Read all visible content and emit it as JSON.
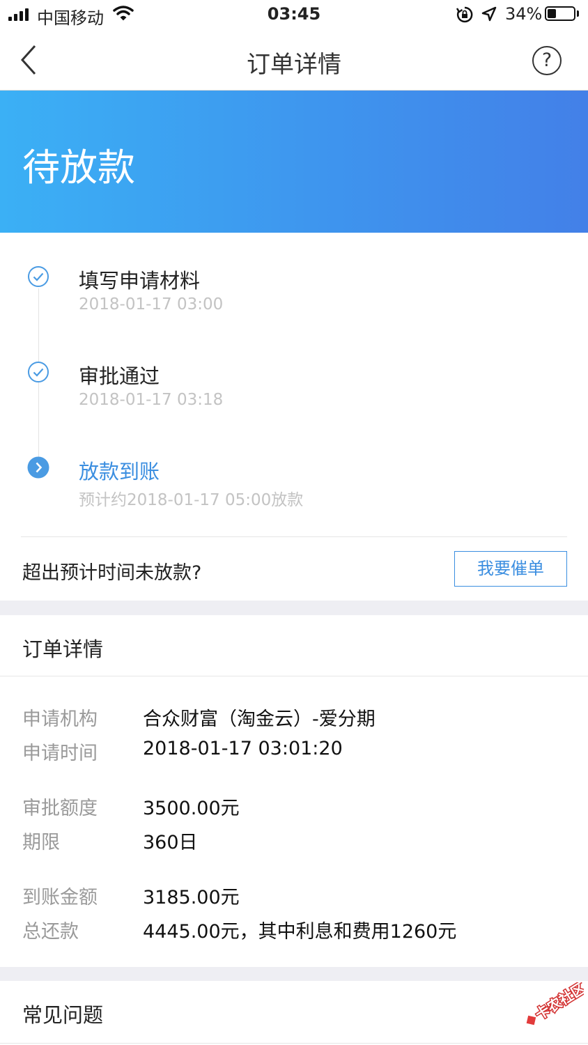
{
  "status_bar": {
    "carrier": "中国移动",
    "time": "03:45",
    "battery_text": "34%",
    "battery_level": 0.34,
    "icons": [
      "signal-icon",
      "wifi-icon",
      "rotation-lock-icon",
      "location-icon",
      "battery-icon"
    ]
  },
  "nav": {
    "title": "订单详情",
    "back_icon": "chevron-left-icon",
    "help_label": "?"
  },
  "banner": {
    "status": "待放款",
    "gradient_start": "#3bb0f5",
    "gradient_end": "#4380e8"
  },
  "timeline": {
    "steps": [
      {
        "title": "填写申请材料",
        "time": "2018-01-17 03:00",
        "icon": "check-circle-icon",
        "state": "done"
      },
      {
        "title": "审批通过",
        "time": "2018-01-17 03:18",
        "icon": "check-circle-icon",
        "state": "done"
      },
      {
        "title": "放款到账",
        "time": "预计约2018-01-17 05:00放款",
        "icon": "chevron-right-circle-icon",
        "state": "active"
      }
    ],
    "overdue_question": "超出预计时间未放款?",
    "urge_button": "我要催单"
  },
  "order_details": {
    "title": "订单详情",
    "rows": [
      {
        "label": "申请机构",
        "value": "合众财富（淘金云）-爱分期"
      },
      {
        "label": "申请时间",
        "value": "2018-01-17 03:01:20"
      },
      {
        "label": "审批额度",
        "value": "3500.00元"
      },
      {
        "label": "期限",
        "value": "360日"
      },
      {
        "label": "到账金额",
        "value": "3185.00元"
      },
      {
        "label": "总还款",
        "value": "4445.00元，其中利息和费用1260元"
      }
    ]
  },
  "faq": {
    "title": "常见问题"
  },
  "watermark": {
    "text": "卡农社区"
  },
  "colors": {
    "accent": "#3b8ee0",
    "muted": "#9a9a9a",
    "timestamp": "#c3c3c3",
    "section_gap": "#eeeef3"
  }
}
